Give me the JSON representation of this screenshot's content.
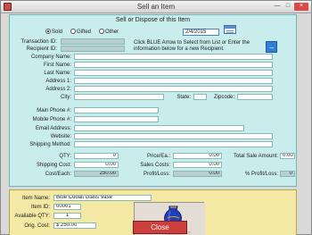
{
  "window": {
    "title": "Sell an Item",
    "minimize_glyph": "—",
    "maximize_glyph": "□",
    "close_glyph": "×"
  },
  "section": {
    "title": "Sell or Dispose of this Item"
  },
  "disposition": {
    "sold": "Sold",
    "gifted": "Gifted",
    "other": "Other",
    "selected": "Sold"
  },
  "date": {
    "value": "2/4/2015"
  },
  "labels": {
    "transaction_id": "Transaction ID:",
    "recipient_id": "Recipient ID:",
    "company_name": "Company Name:",
    "first_name": "First Name:",
    "last_name": "Last Name:",
    "address_1": "Address 1:",
    "address_2": "Address 2:",
    "city": "City:",
    "state": "State:",
    "zipcode": "Zipcode:",
    "main_phone": "Main Phone #:",
    "mobile_phone": "Mobile Phone #:",
    "email": "Email Address:",
    "website": "Website:",
    "shipping_method": "Shipping Method:",
    "qty": "QTY:",
    "price_each": "Price/Ea.:",
    "total_sale_amount": "Total Sale Amount:",
    "shipping_cost": "Shipping Cost:",
    "sales_costs": "Sales Costs:",
    "cost_each": "Cost/Each:",
    "profit_loss": "Profit/Loss:",
    "percent_profit_loss": "% Profit/Loss:",
    "item_name": "Item Name:",
    "item_id": "Item ID:",
    "available_qty": "Available QTY:",
    "orig_cost": "Orig. Cost:"
  },
  "instruction": "Click BLUE Arrow to Select from List or Enter the information below for a new Recipient.",
  "fields": {
    "transaction_id": "",
    "recipient_id": "",
    "company_name": "",
    "first_name": "",
    "last_name": "",
    "address_1": "",
    "address_2": "",
    "city": "",
    "state": "",
    "zipcode": "",
    "main_phone": "",
    "mobile_phone": "",
    "email": "",
    "website": "",
    "shipping_method": ""
  },
  "sale": {
    "qty": "0",
    "price_each": "0.00",
    "total_sale_amount": "0.00",
    "shipping_cost": "0.00",
    "sales_costs": "0.00",
    "cost_each": "250.00",
    "profit_loss": "0.00",
    "percent_profit_loss": "0"
  },
  "item": {
    "name": "Blue Cobalt Glass Vase",
    "id": "00001",
    "available_qty": "1",
    "orig_cost": "$ 250.00"
  },
  "buttons": {
    "close": "Close"
  },
  "icons": {
    "app": "app-icon",
    "calendar": "calendar-icon",
    "select_recipient": "blue-arrow-icon"
  }
}
